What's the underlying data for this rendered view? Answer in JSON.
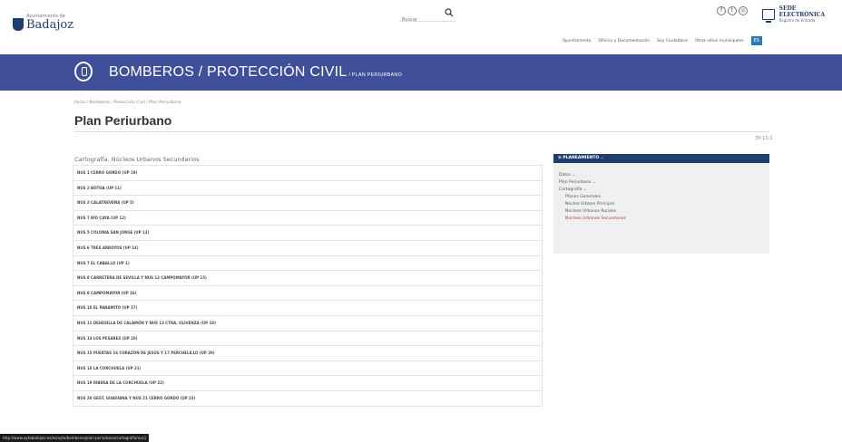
{
  "header": {
    "logo_small": "Ayuntamiento de",
    "logo_big": "Badajoz",
    "search_placeholder": "Buscar",
    "social_icons": [
      "facebook-icon",
      "twitter-icon",
      "instagram-icon"
    ],
    "sede_title": "SEDE ELECTRÓNICA",
    "sede_sub": "Registro de Entrada",
    "nav": [
      "Ayuntamiento",
      "Oficina y Documentación",
      "Soy Ciudadano",
      "Otros sitios municipales"
    ],
    "lang": "ES"
  },
  "banner": {
    "title": "BOMBEROS / PROTECCIÓN CIVIL",
    "subtitle": "/ PLAN PERIURBANO"
  },
  "breadcrumb": "Inicio / Bomberos / Protección Civil / Plan Periurbano",
  "page_title": "Plan Periurbano",
  "date": "30-11-1",
  "section_title": "Cartografía. Núcleos Urbanos Secundarios",
  "items": [
    "NUS 1 CERRO GORDO (UP 19)",
    "NUS 2 BÓTOA (UP 11)",
    "NUS 3 CALATREVEÑA (UP 5)",
    "NUS 7 RÍO CAYA (UP 12)",
    "NUS 5 COLONIA SAN JORGE (UP 13)",
    "NUS 6 TRES ARROYOS (UP 14)",
    "NUS 7 EL CABALLO (UP 1)",
    "NUS 8 CARRETERA DE SEVILLA Y NUS 12 CAMPOMAYOR (UP 15)",
    "NUS 9 CAMPOMAYOR (UP 16)",
    "NUS 10 EL PANAMITO (UP 17)",
    "NUS 11 DEHESILLA DE CALAMÓN Y NUS 13 CTRA. OLIVENZA (UP 18)",
    "NUS 14 LOS PESARES (UP 20)",
    "NUS 15 PUERTAS 16 CORAZÓN DE JESÚS Y 17 PERCHELILLO (UP 20)",
    "NUS 18 LA CORCHUELA (UP 21)",
    "NUS 19 RIBERA DE LA CORCHUELA (UP 22)",
    "NUS 20 GEST. GUADIANA Y NUS 21 CERRO GORDO (UP 23)"
  ],
  "sidebar": {
    "header": "PLANEAMIENTO",
    "items": [
      {
        "label": "Datos",
        "level": 0,
        "active": false
      },
      {
        "label": "Plan Periurbano",
        "level": 0,
        "active": false
      },
      {
        "label": "Cartografía",
        "level": 0,
        "active": false
      },
      {
        "label": "Planos Generales",
        "level": 1,
        "active": false
      },
      {
        "label": "Núcleo Urbano Principal",
        "level": 1,
        "active": false
      },
      {
        "label": "Núcleos Urbanos Rurales",
        "level": 1,
        "active": false
      },
      {
        "label": "Núcleos Urbanos Secundarios",
        "level": 1,
        "active": true
      }
    ]
  },
  "status_url": "http://www.aytobadajoz.es/es/ayto/bomberos/plan-periurbano/cartografia/nus1"
}
